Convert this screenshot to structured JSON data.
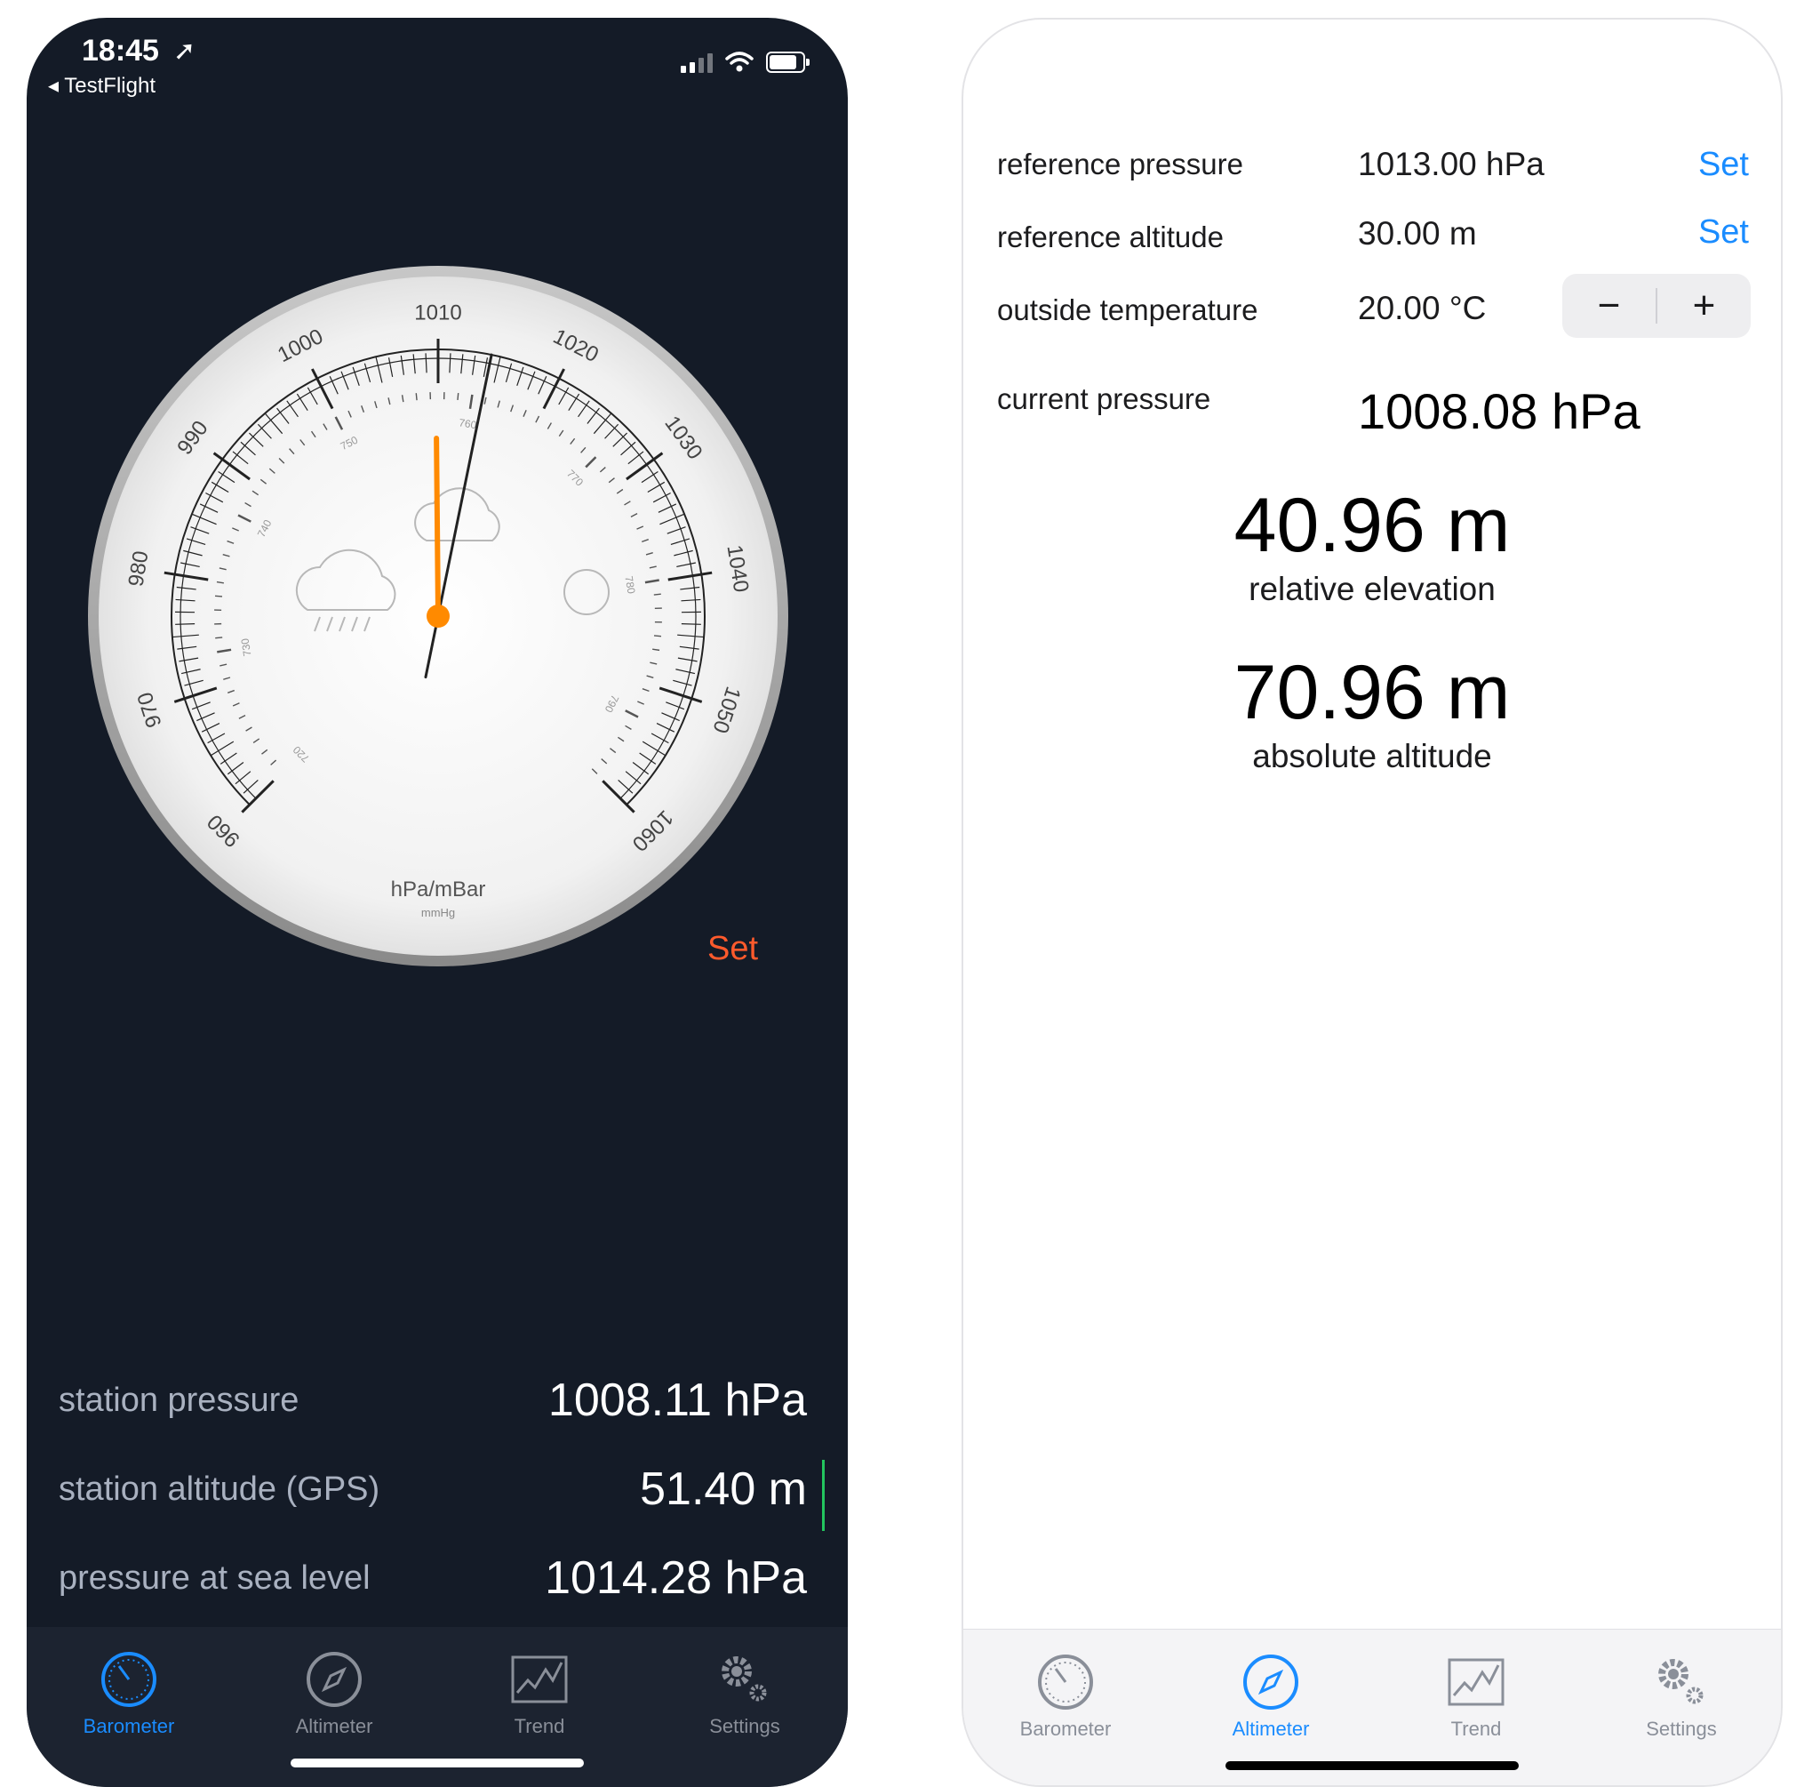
{
  "left_screen": {
    "status_bar": {
      "time": "18:45",
      "location_arrow": "location-arrow-icon",
      "back_link": "◂ TestFlight"
    },
    "gauge": {
      "hpa_ticks": [
        "960",
        "970",
        "980",
        "990",
        "1000",
        "1010",
        "1020",
        "1030",
        "1040",
        "1050",
        "1060"
      ],
      "mmhg_ticks": [
        "720",
        "730",
        "740",
        "750",
        "760",
        "770",
        "780",
        "790"
      ],
      "unit_label": "hPa/mBar",
      "sub_unit_label": "mmHg",
      "black_needle_hpa": 1014.28,
      "orange_needle_hpa": 1009.8,
      "weather_icons": [
        "rain-cloud-icon",
        "cloud-icon",
        "sun-icon"
      ]
    },
    "set_label": "Set",
    "stats": [
      {
        "label": "station pressure",
        "value": "1008.11 hPa"
      },
      {
        "label": "station altitude (GPS)",
        "value": "51.40 m"
      },
      {
        "label": "pressure at sea level",
        "value": "1014.28 hPa"
      }
    ],
    "tabs": [
      {
        "label": "Barometer",
        "icon": "barometer-icon",
        "active": true
      },
      {
        "label": "Altimeter",
        "icon": "compass-icon",
        "active": false
      },
      {
        "label": "Trend",
        "icon": "trend-chart-icon",
        "active": false
      },
      {
        "label": "Settings",
        "icon": "gear-icon",
        "active": false
      }
    ],
    "colors": {
      "background": "#141b27",
      "accent": "#1a8cff",
      "needle": "#ff8a00",
      "set": "#ff5a2c"
    }
  },
  "right_screen": {
    "rows": [
      {
        "label": "reference pressure",
        "value": "1013.00 hPa",
        "action": "Set"
      },
      {
        "label": "reference altitude",
        "value": "30.00 m",
        "action": "Set"
      },
      {
        "label": "outside temperature",
        "value": "20.00 °C"
      },
      {
        "label": "current pressure",
        "value": "1008.08 hPa"
      }
    ],
    "stepper": {
      "minus": "−",
      "plus": "+"
    },
    "relative_elevation": {
      "value": "40.96 m",
      "caption": "relative elevation"
    },
    "absolute_altitude": {
      "value": "70.96 m",
      "caption": "absolute altitude"
    },
    "tabs": [
      {
        "label": "Barometer",
        "icon": "barometer-icon",
        "active": false
      },
      {
        "label": "Altimeter",
        "icon": "compass-icon",
        "active": true
      },
      {
        "label": "Trend",
        "icon": "trend-chart-icon",
        "active": false
      },
      {
        "label": "Settings",
        "icon": "gear-icon",
        "active": false
      }
    ],
    "colors": {
      "background": "#ffffff",
      "accent": "#1a8cff"
    }
  }
}
